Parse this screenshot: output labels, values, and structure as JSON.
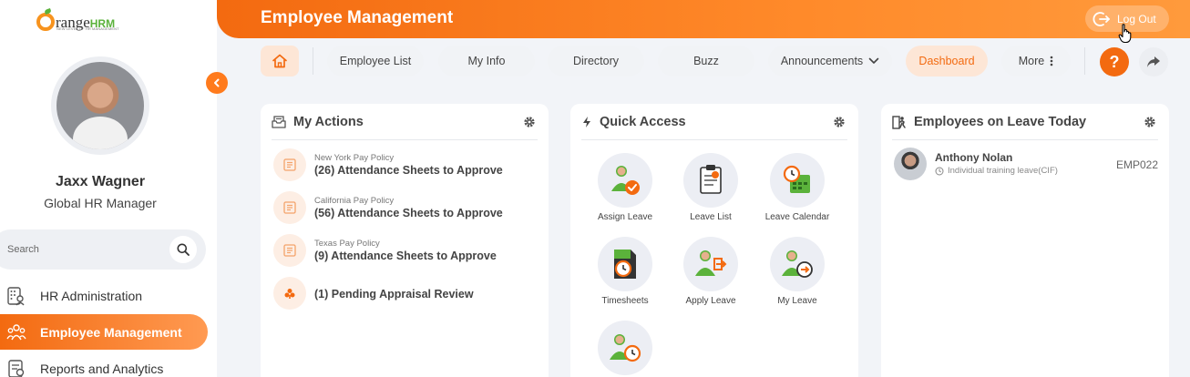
{
  "brand": {
    "logo_main": "range",
    "logo_hrm": "HRM",
    "logo_tagline": "NEW LEVEL OF HR MANAGEMENT"
  },
  "user": {
    "name": "Jaxx Wagner",
    "role": "Global HR Manager"
  },
  "sidebar": {
    "search_placeholder": "Search",
    "items": [
      {
        "label": "HR Administration"
      },
      {
        "label": "Employee Management"
      },
      {
        "label": "Reports and Analytics"
      }
    ]
  },
  "header": {
    "title": "Employee Management",
    "logout_label": "Log Out"
  },
  "topnav": {
    "items": [
      {
        "label": "Employee List"
      },
      {
        "label": "My Info"
      },
      {
        "label": "Directory"
      },
      {
        "label": "Buzz"
      },
      {
        "label": "Announcements"
      },
      {
        "label": "Dashboard"
      },
      {
        "label": "More"
      }
    ],
    "help_symbol": "?"
  },
  "my_actions": {
    "title": "My Actions",
    "items": [
      {
        "sub": "New York Pay Policy",
        "main": "(26) Attendance Sheets to Approve"
      },
      {
        "sub": "California Pay Policy",
        "main": "(56) Attendance Sheets to Approve"
      },
      {
        "sub": "Texas Pay Policy",
        "main": "(9) Attendance Sheets to Approve"
      },
      {
        "sub": "",
        "main": "(1) Pending Appraisal Review"
      }
    ]
  },
  "quick_access": {
    "title": "Quick Access",
    "items": [
      {
        "label": "Assign Leave",
        "icon": "assign-leave-icon"
      },
      {
        "label": "Leave List",
        "icon": "leave-list-icon"
      },
      {
        "label": "Leave Calendar",
        "icon": "leave-calendar-icon"
      },
      {
        "label": "Timesheets",
        "icon": "timesheets-icon"
      },
      {
        "label": "Apply Leave",
        "icon": "apply-leave-icon"
      },
      {
        "label": "My Leave",
        "icon": "my-leave-icon"
      },
      {
        "label": "",
        "icon": "attendance-icon"
      }
    ]
  },
  "employees_on_leave": {
    "title": "Employees on Leave Today",
    "items": [
      {
        "name": "Anthony Nolan",
        "type": "Individual training leave(CIF)",
        "id": "EMP022"
      }
    ]
  },
  "colors": {
    "accent": "#f36a10",
    "accent_light": "#fde6d6",
    "icon_green": "#5bb23b"
  }
}
